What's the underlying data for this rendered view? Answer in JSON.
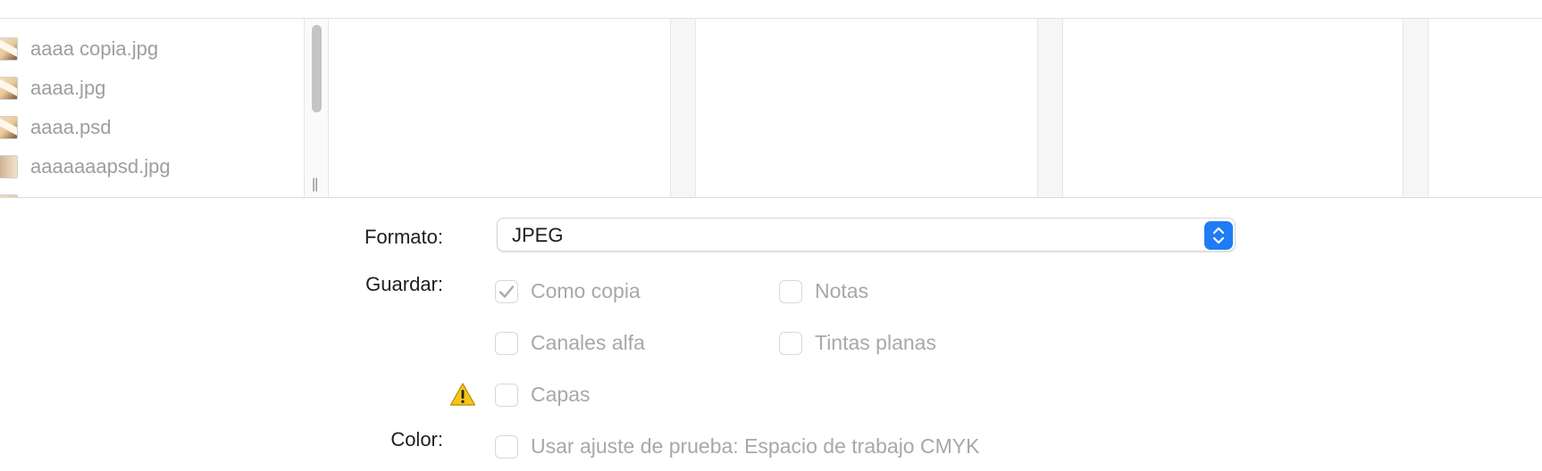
{
  "file_browser": {
    "files": [
      {
        "name": "aaaa copia.jpg",
        "thumb": "photo"
      },
      {
        "name": "aaaa.jpg",
        "thumb": "photo"
      },
      {
        "name": "aaaa.psd",
        "thumb": "photo"
      },
      {
        "name": "aaaaaaapsd.jpg",
        "thumb": "gradient"
      }
    ],
    "resize_handle_glyph": "||"
  },
  "options": {
    "format": {
      "label": "Formato:",
      "value": "JPEG"
    },
    "save": {
      "label": "Guardar:",
      "checkboxes": [
        {
          "label": "Como copia",
          "checked": true,
          "enabled": false
        },
        {
          "label": "Notas",
          "checked": false,
          "enabled": false
        },
        {
          "label": "Canales alfa",
          "checked": false,
          "enabled": false
        },
        {
          "label": "Tintas planas",
          "checked": false,
          "enabled": false
        },
        {
          "label": "Capas",
          "checked": false,
          "enabled": false
        }
      ],
      "warning_icon": "warning-icon"
    },
    "color": {
      "label": "Color:",
      "checkbox": {
        "label": "Usar ajuste de prueba: Espacio de trabajo CMYK",
        "checked": false,
        "enabled": false
      }
    }
  },
  "colors": {
    "accent": "#1f7cf5",
    "disabled_text": "#a8a8a8",
    "warning": "#f5c518"
  }
}
